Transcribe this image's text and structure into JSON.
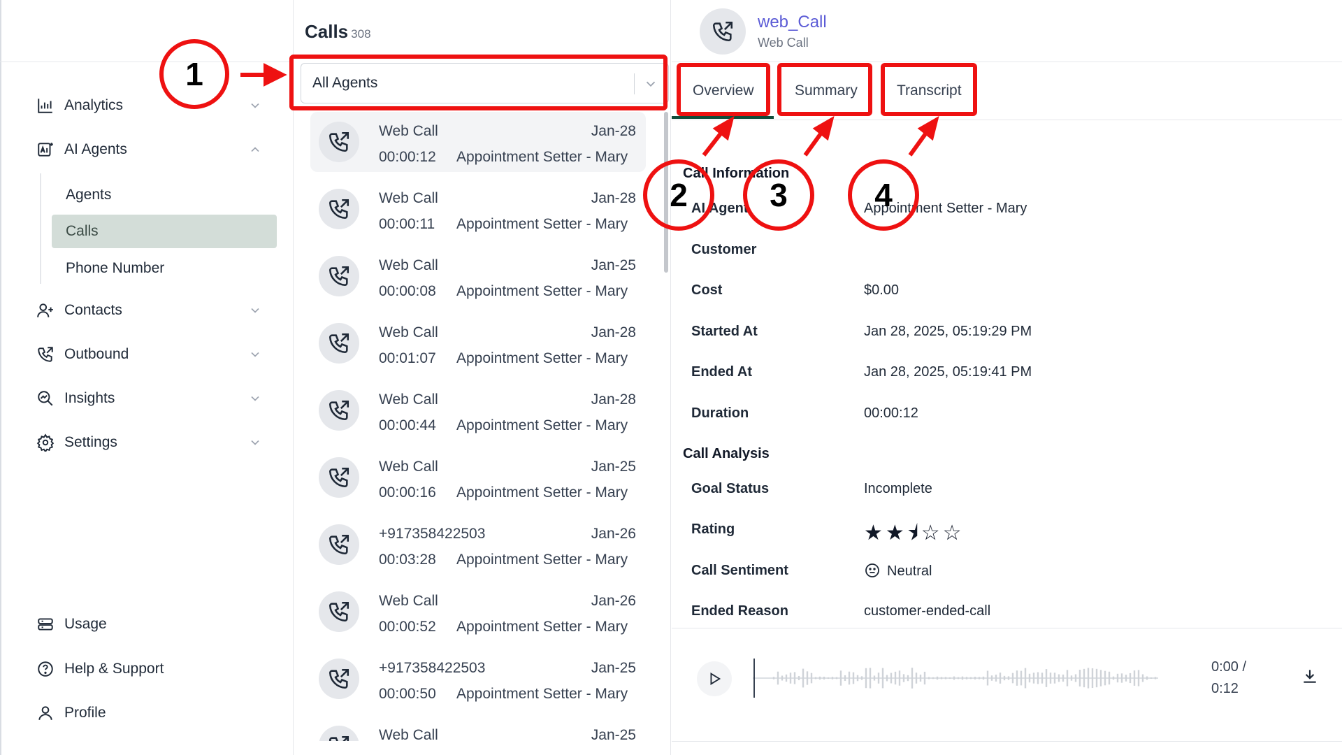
{
  "sidebar": {
    "items": [
      {
        "label": "Analytics",
        "icon": "analytics-icon",
        "expanded": false
      },
      {
        "label": "AI Agents",
        "icon": "ai-agents-icon",
        "expanded": true
      },
      {
        "label": "Contacts",
        "icon": "contacts-icon",
        "expanded": false
      },
      {
        "label": "Outbound",
        "icon": "outbound-icon",
        "expanded": false
      },
      {
        "label": "Insights",
        "icon": "insights-icon",
        "expanded": false
      },
      {
        "label": "Settings",
        "icon": "settings-icon",
        "expanded": false
      }
    ],
    "sub_items": [
      {
        "label": "Agents",
        "active": false
      },
      {
        "label": "Calls",
        "active": true
      },
      {
        "label": "Phone Number",
        "active": false
      }
    ],
    "bottom": [
      {
        "label": "Usage",
        "icon": "usage-icon"
      },
      {
        "label": "Help & Support",
        "icon": "help-icon"
      },
      {
        "label": "Profile",
        "icon": "profile-icon"
      }
    ]
  },
  "calls": {
    "title": "Calls",
    "count": "308",
    "filter": {
      "value": "All Agents"
    },
    "items": [
      {
        "name": "Web Call",
        "date": "Jan-28",
        "duration": "00:00:12",
        "agent": "Appointment Setter - Mary"
      },
      {
        "name": "Web Call",
        "date": "Jan-28",
        "duration": "00:00:11",
        "agent": "Appointment Setter - Mary"
      },
      {
        "name": "Web Call",
        "date": "Jan-25",
        "duration": "00:00:08",
        "agent": "Appointment Setter - Mary"
      },
      {
        "name": "Web Call",
        "date": "Jan-28",
        "duration": "00:01:07",
        "agent": "Appointment Setter - Mary"
      },
      {
        "name": "Web Call",
        "date": "Jan-28",
        "duration": "00:00:44",
        "agent": "Appointment Setter - Mary"
      },
      {
        "name": "Web Call",
        "date": "Jan-25",
        "duration": "00:00:16",
        "agent": "Appointment Setter - Mary"
      },
      {
        "name": "+917358422503",
        "date": "Jan-26",
        "duration": "00:03:28",
        "agent": "Appointment Setter - Mary"
      },
      {
        "name": "Web Call",
        "date": "Jan-26",
        "duration": "00:00:52",
        "agent": "Appointment Setter - Mary"
      },
      {
        "name": "+917358422503",
        "date": "Jan-25",
        "duration": "00:00:50",
        "agent": "Appointment Setter - Mary"
      },
      {
        "name": "Web Call",
        "date": "Jan-25",
        "duration": "",
        "agent": ""
      }
    ]
  },
  "detail": {
    "title": "web_Call",
    "subtitle": "Web Call",
    "tabs": [
      "Overview",
      "Summary",
      "Transcript"
    ],
    "call_information": {
      "heading": "Call Information",
      "rows": [
        {
          "label": "AI Agent",
          "value": "Appointment Setter - Mary"
        },
        {
          "label": "Customer",
          "value": ""
        },
        {
          "label": "Cost",
          "value": "$0.00"
        },
        {
          "label": "Started At",
          "value": "Jan 28, 2025, 05:19:29 PM"
        },
        {
          "label": "Ended At",
          "value": "Jan 28, 2025, 05:19:41 PM"
        },
        {
          "label": "Duration",
          "value": "00:00:12"
        }
      ]
    },
    "call_analysis": {
      "heading": "Call Analysis",
      "goal_status_label": "Goal Status",
      "goal_status": "Incomplete",
      "rating_label": "Rating",
      "rating": 2.5,
      "rating_max": 5,
      "sentiment_label": "Call Sentiment",
      "sentiment": "Neutral",
      "ended_reason_label": "Ended Reason",
      "ended_reason": "customer-ended-call"
    },
    "player": {
      "current": "0:00 /",
      "total": "0:12"
    }
  },
  "annotations": [
    "1",
    "2",
    "3",
    "4"
  ],
  "colors": {
    "accent": "#5b5bd6",
    "active_tab": "#0f4c3a",
    "annotation": "#ee1111",
    "active_nav": "#d3ddd8"
  }
}
